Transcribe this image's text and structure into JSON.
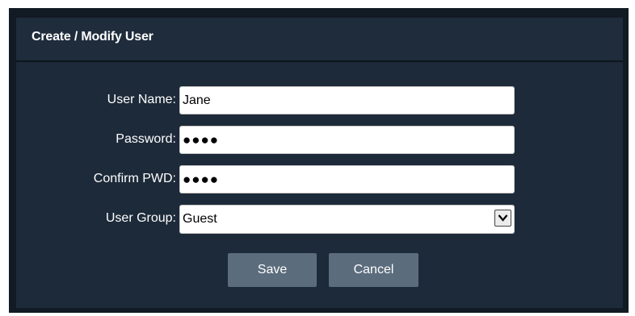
{
  "dialog": {
    "title": "Create / Modify User"
  },
  "form": {
    "username": {
      "label": "User Name:",
      "value": "Jane"
    },
    "password": {
      "label": "Password:",
      "masked_value": "●●●●"
    },
    "confirm_password": {
      "label": "Confirm PWD:",
      "masked_value": "●●●●"
    },
    "user_group": {
      "label": "User Group:",
      "selected": "Guest"
    }
  },
  "buttons": {
    "save_label": "Save",
    "cancel_label": "Cancel"
  },
  "colors": {
    "frame_background": "#121a24",
    "dialog_background": "#1d2a39",
    "button_background": "#5b6c7d",
    "text": "#ffffff"
  },
  "icons": {
    "dropdown": "chevron-down-icon"
  }
}
